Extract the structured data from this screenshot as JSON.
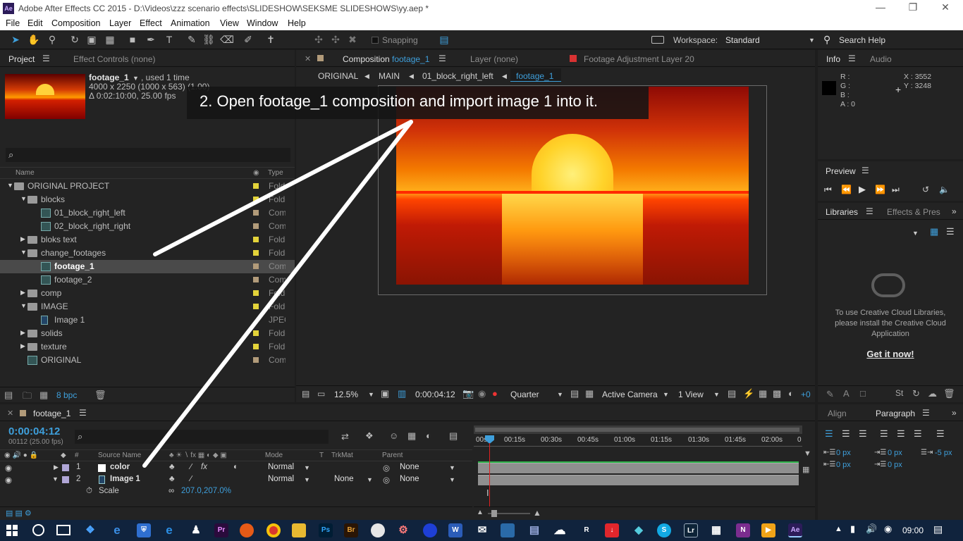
{
  "window": {
    "title": "Adobe After Effects CC 2015 - D:\\Videos\\zzz scenario effects\\SLIDESHOW\\SEKSME SLIDESHOWS\\yy.aep *",
    "logo": "Ae"
  },
  "menu": [
    "File",
    "Edit",
    "Composition",
    "Layer",
    "Effect",
    "Animation",
    "View",
    "Window",
    "Help"
  ],
  "toolbar": {
    "snapping": "Snapping",
    "workspace_label": "Workspace:",
    "workspace_value": "Standard",
    "search": "Search Help"
  },
  "project_panel": {
    "tabs": [
      "Project",
      "Effect Controls (none)"
    ],
    "item_name": "footage_1",
    "used": ", used 1 time",
    "dims": "4000 x 2250  (1000 x 563) (1.00)",
    "duration": "Δ 0:02:10:00, 25.00 fps",
    "search_placeholder": "⌕",
    "col_name": "Name",
    "col_type": "Type",
    "items": [
      {
        "label": "ORIGINAL PROJECT",
        "type": "Folder",
        "indent": 0,
        "kind": "folder",
        "tri": "open",
        "color": "#e3d33a"
      },
      {
        "label": "blocks",
        "type": "Folder",
        "indent": 1,
        "kind": "folder",
        "tri": "open",
        "color": "#e3d33a"
      },
      {
        "label": "01_block_right_left",
        "type": "Comp",
        "indent": 2,
        "kind": "comp",
        "tri": "",
        "color": "#b29b7a"
      },
      {
        "label": "02_block_right_right",
        "type": "Comp",
        "indent": 2,
        "kind": "comp",
        "tri": "",
        "color": "#b29b7a"
      },
      {
        "label": "bloks text",
        "type": "Folder",
        "indent": 1,
        "kind": "folder",
        "tri": "closed",
        "color": "#e3d33a"
      },
      {
        "label": "change_footages",
        "type": "Folder",
        "indent": 1,
        "kind": "folder",
        "tri": "open",
        "color": "#e3d33a"
      },
      {
        "label": "footage_1",
        "type": "Comp",
        "indent": 2,
        "kind": "comp",
        "tri": "",
        "color": "#b29b7a",
        "selected": true
      },
      {
        "label": "footage_2",
        "type": "Comp",
        "indent": 2,
        "kind": "comp",
        "tri": "",
        "color": "#b29b7a"
      },
      {
        "label": "comp",
        "type": "Folder",
        "indent": 1,
        "kind": "folder",
        "tri": "closed",
        "color": "#e3d33a"
      },
      {
        "label": "IMAGE",
        "type": "Folder",
        "indent": 1,
        "kind": "folder",
        "tri": "open",
        "color": "#e3d33a"
      },
      {
        "label": "Image 1",
        "type": "JPEG",
        "indent": 2,
        "kind": "image",
        "tri": "",
        "color": ""
      },
      {
        "label": "solids",
        "type": "Folder",
        "indent": 1,
        "kind": "folder",
        "tri": "closed",
        "color": "#e3d33a"
      },
      {
        "label": "texture",
        "type": "Folder",
        "indent": 1,
        "kind": "folder",
        "tri": "closed",
        "color": "#e3d33a"
      },
      {
        "label": "ORIGINAL",
        "type": "Comp",
        "indent": 1,
        "kind": "comp",
        "tri": "",
        "color": "#b29b7a"
      }
    ],
    "bpc": "8 bpc"
  },
  "comp_panel": {
    "tab_comp_prefix": "Composition",
    "tab_comp_name": "footage_1",
    "tab_layer": "Layer (none)",
    "tab_footage": "Footage Adjustment Layer 20",
    "breadcrumbs": [
      "ORIGINAL",
      "MAIN",
      "01_block_right_left",
      "footage_1"
    ],
    "annotation": "2.   Open footage_1 composition and import image 1 into it.",
    "zoom": "12.5%",
    "timecode": "0:00:04:12",
    "resolution": "Quarter",
    "camera": "Active Camera",
    "view": "1 View",
    "offset": "+0"
  },
  "info_panel": {
    "tabs": [
      "Info",
      "Audio"
    ],
    "r": "R :",
    "g": "G :",
    "b": "B :",
    "a": "A : 0",
    "x": "X : 3552",
    "y": "Y : 3248"
  },
  "preview_panel": {
    "title": "Preview"
  },
  "libraries_panel": {
    "tabs": [
      "Libraries",
      "Effects & Pres"
    ],
    "message": "To use Creative Cloud Libraries, please install the Creative Cloud Application",
    "link": "Get it now!"
  },
  "paragraph_panel": {
    "tabs": [
      "Align",
      "Paragraph"
    ],
    "indent_left": "0 px",
    "indent_first": "0 px",
    "indent_right": "-5 px",
    "space_before": "0 px",
    "space_after": "0 px"
  },
  "timeline": {
    "tab": "footage_1",
    "timecode": "0:00:04:12",
    "frames": "00112 (25.00 fps)",
    "search_placeholder": "⌕",
    "col_num": "#",
    "col_source": "Source Name",
    "col_mode": "Mode",
    "col_t": "T",
    "col_trkmat": "TrkMat",
    "col_parent": "Parent",
    "ruler": [
      "00s",
      "00:15s",
      "00:30s",
      "00:45s",
      "01:00s",
      "01:15s",
      "01:30s",
      "01:45s",
      "02:00s",
      "0"
    ],
    "layers": [
      {
        "num": "1",
        "name": "color",
        "mode": "Normal",
        "trkmat": "",
        "parent": "None"
      },
      {
        "num": "2",
        "name": "Image 1",
        "mode": "Normal",
        "trkmat": "None",
        "parent": "None"
      }
    ],
    "prop_name": "Scale",
    "prop_value": "207.0,207.0%"
  },
  "taskbar": {
    "time": "09:00"
  },
  "colors": {
    "accent": "#3e9fdb",
    "panel": "#232323",
    "bg": "#1d1d1d",
    "timebar": "#8f8f8f",
    "green": "#2db34a",
    "playhead": "#e02020"
  }
}
